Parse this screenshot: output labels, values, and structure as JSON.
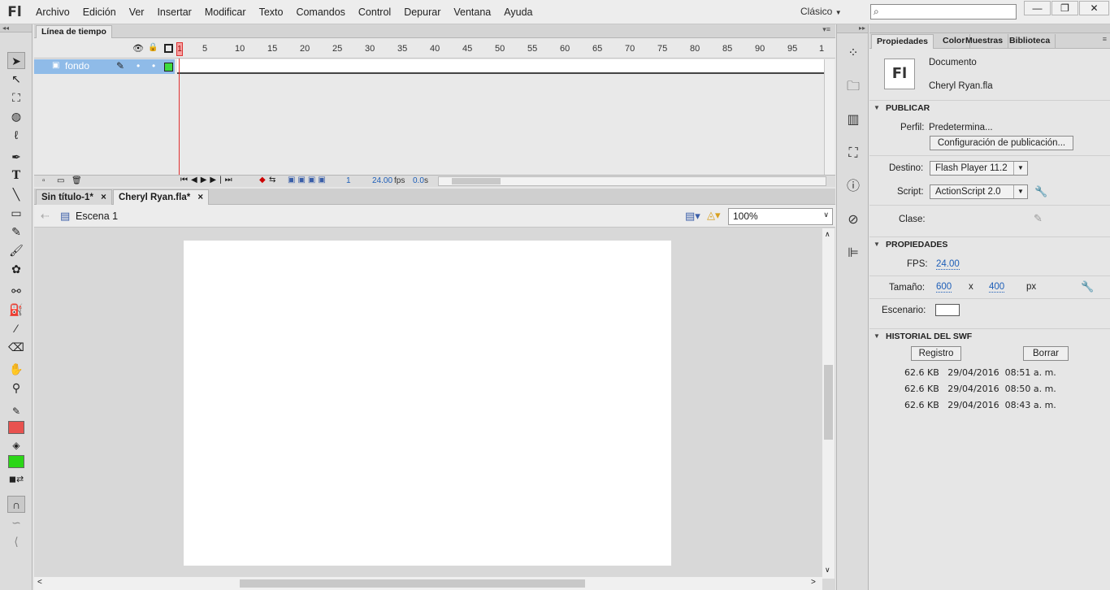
{
  "app": {
    "logo": "Fl",
    "workspace": "Clásico"
  },
  "menu": [
    "Archivo",
    "Edición",
    "Ver",
    "Insertar",
    "Modificar",
    "Texto",
    "Comandos",
    "Control",
    "Depurar",
    "Ventana",
    "Ayuda"
  ],
  "window_controls": {
    "minimize": "—",
    "restore": "❐",
    "close": "✕"
  },
  "timeline": {
    "tab": "Línea de tiempo",
    "frame_numbers": [
      "1",
      "5",
      "10",
      "15",
      "20",
      "25",
      "30",
      "35",
      "40",
      "45",
      "50",
      "55",
      "60",
      "65",
      "70",
      "75",
      "80",
      "85",
      "90",
      "95",
      "1"
    ],
    "layer_name": "fondo",
    "current_frame": "1",
    "fps": "24.00",
    "fps_unit": "fps",
    "elapsed": "0.0",
    "elapsed_unit": "s"
  },
  "documents": {
    "tabs": [
      {
        "label": "Sin título-1*",
        "close": "×"
      },
      {
        "label": "Cheryl Ryan.fla*",
        "close": "×"
      }
    ],
    "scene": "Escena 1",
    "zoom": "100%"
  },
  "colors": {
    "stroke": "#e8524f",
    "fill": "#2bd617",
    "stage": "#ffffff"
  },
  "properties": {
    "tabs": [
      "Propiedades",
      "Color",
      "Muestras",
      "Biblioteca"
    ],
    "doc_icon": "Fl",
    "doc_type": "Documento",
    "doc_name": "Cheryl Ryan.fla",
    "publish": {
      "header": "PUBLICAR",
      "profile_label": "Perfil:",
      "profile_value": "Predetermina...",
      "config_button": "Configuración de publicación...",
      "target_label": "Destino:",
      "target_value": "Flash Player 11.2",
      "script_label": "Script:",
      "script_value": "ActionScript 2.0",
      "class_label": "Clase:"
    },
    "props": {
      "header": "PROPIEDADES",
      "fps_label": "FPS:",
      "fps_value": "24.00",
      "size_label": "Tamaño:",
      "width": "600",
      "x": "x",
      "height": "400",
      "unit": "px",
      "stage_label": "Escenario:"
    },
    "history": {
      "header": "HISTORIAL DEL SWF",
      "log_button": "Registro",
      "clear_button": "Borrar",
      "entries": [
        {
          "size": "62.6 KB",
          "date": "29/04/2016",
          "time": "08:51 a. m."
        },
        {
          "size": "62.6 KB",
          "date": "29/04/2016",
          "time": "08:50 a. m."
        },
        {
          "size": "62.6 KB",
          "date": "29/04/2016",
          "time": "08:43 a. m."
        }
      ]
    }
  }
}
